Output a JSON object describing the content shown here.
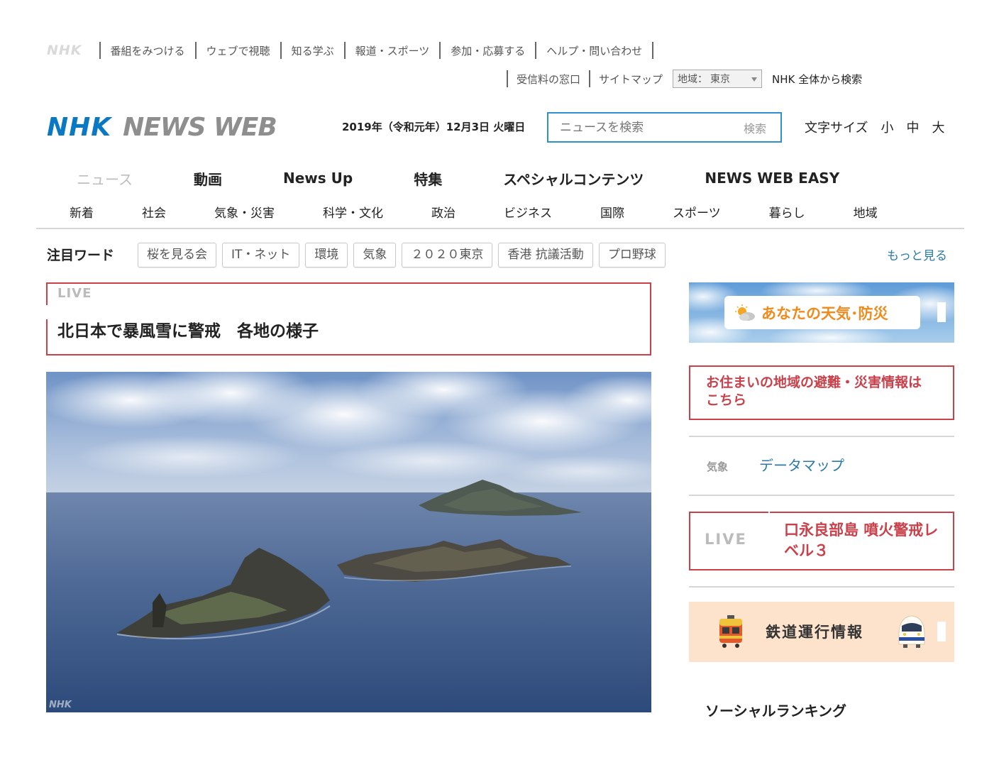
{
  "global_nav": {
    "logo": "NHK",
    "items": [
      "番組をみつける",
      "ウェブで視聴",
      "知る学ぶ",
      "報道・スポーツ",
      "参加・応募する",
      "ヘルプ・問い合わせ"
    ],
    "sub_items": [
      "受信料の窓口",
      "サイトマップ"
    ],
    "region_label": "地域：",
    "region_value": "東京",
    "search_all": "NHK 全体から検索"
  },
  "header": {
    "logo_nhk": "NHK",
    "logo_newsweb": "NEWS WEB",
    "date": "2019年（令和元年）12月3日 火曜日",
    "search_placeholder": "ニュースを検索",
    "search_button": "検索",
    "fontsize_label": "文字サイズ",
    "fontsize_small": "小",
    "fontsize_medium": "中",
    "fontsize_large": "大"
  },
  "main_nav": [
    "ニュース",
    "動画",
    "News Up",
    "特集",
    "スペシャルコンテンツ",
    "NEWS WEB EASY"
  ],
  "sub_nav": [
    "新着",
    "社会",
    "気象・災害",
    "科学・文化",
    "政治",
    "ビジネス",
    "国際",
    "スポーツ",
    "暮らし",
    "地域"
  ],
  "keywords": {
    "title": "注目ワード",
    "tags": [
      "桜を見る会",
      "IT・ネット",
      "環境",
      "気象",
      "２０２０東京",
      "香港 抗議活動",
      "プロ野球"
    ],
    "more": "もっと見る"
  },
  "headline": {
    "tag": "LIVE",
    "title": "北日本で暴風雪に警戒　各地の様子"
  },
  "hero": {
    "watermark": "NHK"
  },
  "sidebar": {
    "weather_banner": "あなたの天気･防災",
    "evac_link": "お住まいの地域の避難・災害情報はこちら",
    "weather_category": "気象",
    "weather_link": "データマップ",
    "live_tag": "LIVE",
    "live_title": "口永良部島 噴火警戒レベル３",
    "rail_banner": "鉄道運行情報",
    "ranking_title": "ソーシャルランキング"
  },
  "colors": {
    "brand_blue": "#0a78c2",
    "live_red": "#c9414b",
    "link_blue": "#2b7aa8",
    "weather_orange": "#f08a1c",
    "rail_bg": "#fde3cb"
  }
}
